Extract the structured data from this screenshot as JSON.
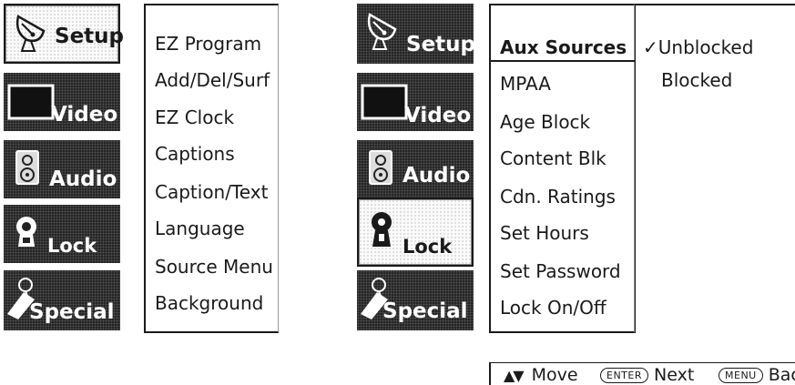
{
  "left_panel": {
    "tabs": [
      {
        "label": "Setup",
        "icon": "satellite-dish-icon",
        "active": true
      },
      {
        "label": "Video",
        "icon": "monitor-icon",
        "active": false
      },
      {
        "label": "Audio",
        "icon": "speaker-icon",
        "active": false
      },
      {
        "label": "Lock",
        "icon": "lock-icon",
        "active": false
      },
      {
        "label": "Special",
        "icon": "tag-icon",
        "active": false
      }
    ],
    "menu_items": [
      "EZ Program",
      "Add/Del/Surf",
      "EZ Clock",
      "Captions",
      "Caption/Text",
      "Language",
      "Source Menu",
      "Background"
    ]
  },
  "right_panel": {
    "tabs": [
      {
        "label": "Setup",
        "icon": "satellite-dish-icon",
        "active": false
      },
      {
        "label": "Video",
        "icon": "monitor-icon",
        "active": false
      },
      {
        "label": "Audio",
        "icon": "speaker-icon",
        "active": false
      },
      {
        "label": "Lock",
        "icon": "lock-icon",
        "active": true
      },
      {
        "label": "Special",
        "icon": "tag-icon",
        "active": false
      }
    ],
    "menu_items": [
      "Aux Sources",
      "MPAA",
      "Age Block",
      "Content Blk",
      "Cdn. Ratings",
      "Set Hours",
      "Set Password",
      "Lock On/Off"
    ],
    "selected_item": "Aux Sources",
    "options": [
      {
        "label": "Unblocked",
        "checked": true,
        "check_mark": "✓"
      },
      {
        "label": "Blocked",
        "checked": false,
        "check_mark": ""
      }
    ]
  },
  "help_bar": {
    "move_arrows": "▲▼",
    "move_label": "Move",
    "enter_key": "ENTER",
    "next_label": "Next",
    "menu_key": "MENU",
    "back_label": "Back"
  }
}
